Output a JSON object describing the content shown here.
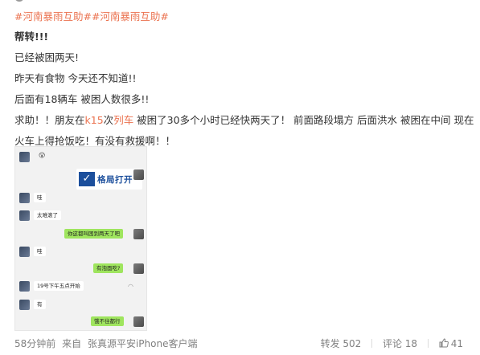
{
  "hashtags": [
    "#河南暴雨互助#",
    "#河南暴雨互助#"
  ],
  "post": {
    "line1": "帮转!!!",
    "line2": "已经被困两天!",
    "line3": "昨天有食物 今天还不知道!!",
    "line4": "后面有18辆车 被困人数很多!!",
    "line5_pre": "求助！！朋友在",
    "line5_k15": "k15",
    "line5_mid": "次",
    "line5_train": "列车",
    "line5_post": " 被困了30多个小时已经快两天了！ 前面路段塌方 后面洪水 被困在中间 现在火车上得抢饭吃！有没有救援啊！！"
  },
  "chat": {
    "emoji": "😮",
    "card_text": "格局打开",
    "m1": "哇",
    "m2": "太难滚了",
    "m3": "你这都叫困到两天了吧",
    "m4": "哇",
    "m5": "有泡面吃?",
    "m6": "19号下午五点开始",
    "m7": "有",
    "m8": "饿不住都行"
  },
  "footer": {
    "time": "58分钟前",
    "source_prefix": "来自",
    "source": "张真源平安iPhone客户端",
    "repost": "转发 502",
    "comment": "评论 18",
    "like": "41"
  },
  "colors": {
    "accent": "#eb7350",
    "text": "#333333",
    "meta": "#808080"
  }
}
